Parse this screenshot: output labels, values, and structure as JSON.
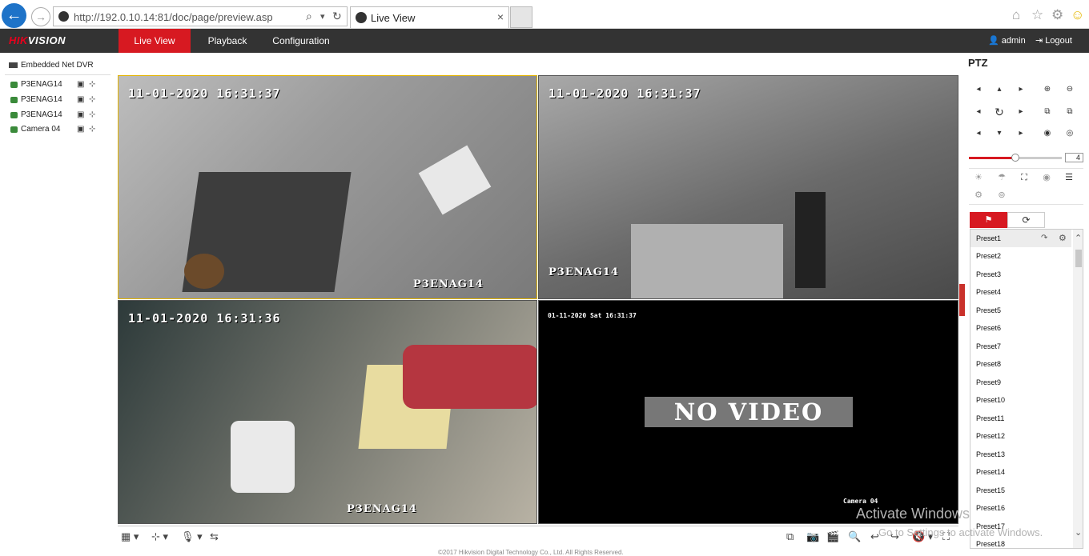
{
  "browser": {
    "url": "http://192.0.10.14:81/doc/page/preview.asp",
    "tab_title": "Live View",
    "tab_close": "×",
    "back_icon": "←",
    "forward_icon": "→",
    "search_icon": "⌕",
    "dropdown_icon": "▾",
    "refresh_icon": "↻",
    "home_icon": "⌂",
    "star_icon": "☆",
    "gear_icon": "⚙",
    "smiley_icon": "☺"
  },
  "app": {
    "brand_part1": "HIK",
    "brand_part2": "VISION",
    "nav": [
      "Live View",
      "Playback",
      "Configuration"
    ],
    "user": "admin",
    "logout": "Logout",
    "user_icon": "👤",
    "logout_icon": "⇥"
  },
  "tree": {
    "root": "Embedded Net DVR",
    "cameras": [
      {
        "name": "P3ENAG14"
      },
      {
        "name": "P3ENAG14"
      },
      {
        "name": "P3ENAG14"
      },
      {
        "name": "Camera 04"
      }
    ],
    "record_icon": "▣",
    "ptz_icon": "⊹"
  },
  "tiles": [
    {
      "timestamp": "11-01-2020 16:31:37",
      "name": "P3ENAG14"
    },
    {
      "timestamp": "11-01-2020 16:31:37",
      "name": "P3ENAG14"
    },
    {
      "timestamp": "11-01-2020 16:31:36",
      "name": "P3ENAG14"
    },
    {
      "timestamp": "01-11-2020 Sat 16:31:37",
      "name": "Camera 04",
      "status": "NO VIDEO"
    }
  ],
  "toolbar": {
    "left": [
      "▦ ▾",
      "⊹ ▾",
      "🎙 ▾",
      "⇆"
    ],
    "right": [
      "⧉",
      "📷",
      "🎬",
      "🔍",
      "↩",
      "↪",
      "🔇 ▾",
      "⛶"
    ]
  },
  "copyright": "©2017 Hikvision Digital Technology Co., Ltd. All Rights Reserved.",
  "ptz": {
    "title": "PTZ",
    "direction_pad": [
      "◂",
      "▴",
      "▸",
      "◂",
      "↻",
      "▸",
      "◂",
      "▾",
      "▸"
    ],
    "zoom_buttons": [
      "⊕",
      "⊖",
      "⧉",
      "⧉",
      "◉",
      "◎"
    ],
    "speed": 4,
    "speed_fraction": 0.5,
    "function_row1": [
      "☀",
      "☂",
      "⛶",
      "◉",
      "☰"
    ],
    "function_row2": [
      "⚙",
      "⊚"
    ],
    "preset_tab_icon": "⚑",
    "patrol_tab_icon": "⟳",
    "presets": [
      "Preset1",
      "Preset2",
      "Preset3",
      "Preset4",
      "Preset5",
      "Preset6",
      "Preset7",
      "Preset8",
      "Preset9",
      "Preset10",
      "Preset11",
      "Preset12",
      "Preset13",
      "Preset14",
      "Preset15",
      "Preset16",
      "Preset17",
      "Preset18"
    ],
    "call_icon": "↷",
    "settings_icon": "⚙",
    "scroll_up": "⌃",
    "scroll_down": "⌄"
  },
  "watermark": {
    "line1": "Activate Windows",
    "line2": "Go to Settings to activate Windows."
  }
}
